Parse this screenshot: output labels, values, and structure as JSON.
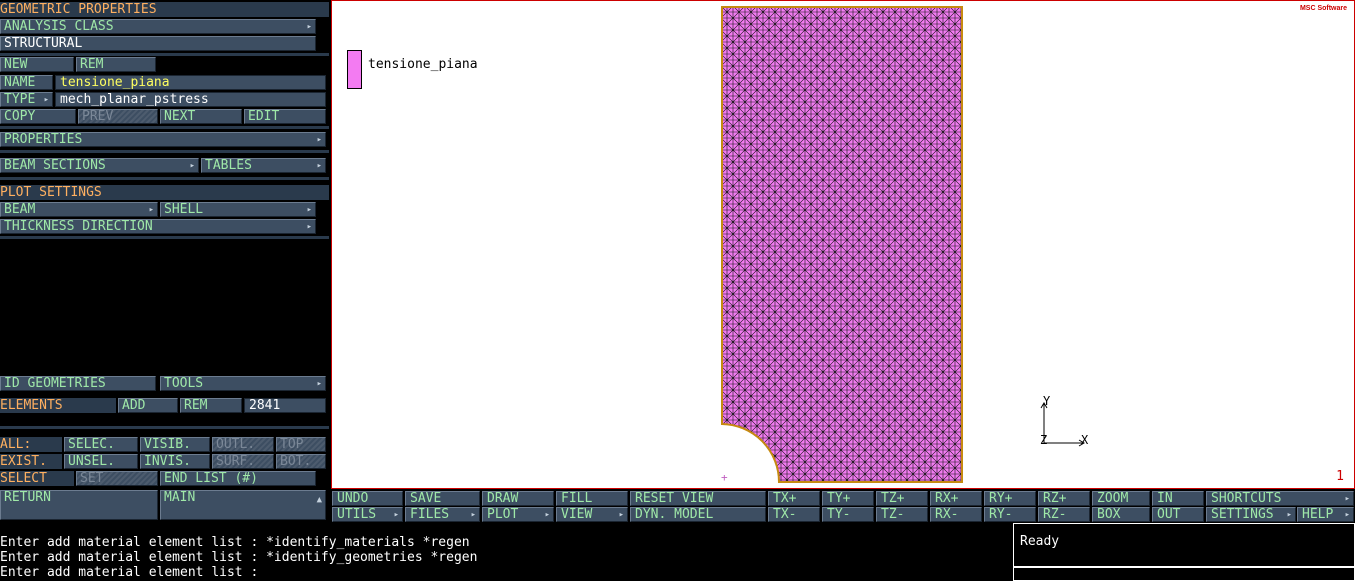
{
  "left_panel": {
    "geometric_properties": "GEOMETRIC PROPERTIES",
    "analysis_class": "ANALYSIS CLASS",
    "analysis_class_value": "STRUCTURAL",
    "new": "NEW",
    "rem": "REM",
    "name_label": "NAME",
    "name_value": "tensione_piana",
    "type_label": "TYPE",
    "type_value": "mech_planar_pstress",
    "copy": "COPY",
    "prev": "PREV",
    "next": "NEXT",
    "edit": "EDIT",
    "properties": "PROPERTIES",
    "beam_sections": "BEAM SECTIONS",
    "tables": "TABLES",
    "plot_settings": "PLOT SETTINGS",
    "beam": "BEAM",
    "shell": "SHELL",
    "thickness_direction": "THICKNESS DIRECTION",
    "id_geometries": "ID GEOMETRIES",
    "tools": "TOOLS",
    "elements": "ELEMENTS",
    "add": "ADD",
    "rem2": "REM",
    "element_count": "2841",
    "all": "ALL:",
    "selec": "SELEC.",
    "visib": "VISIB.",
    "outl": "OUTL.",
    "top": "TOP",
    "exist": "EXIST.",
    "unsel": "UNSEL.",
    "invis": "INVIS.",
    "surf": "SURF.",
    "bot": "BOT.",
    "select": "SELECT",
    "set": "SET",
    "end_list": "END LIST (#)",
    "return": "RETURN",
    "main": "MAIN"
  },
  "viewport": {
    "legend_label": "tensione_piana",
    "legend_color": "#f37bf2",
    "viewport_number": "1",
    "logo": "MSC Software",
    "axis_y": "Y",
    "axis_x": "X",
    "axis_z": "Z",
    "origin_mark": "+"
  },
  "toolbar": {
    "row1": [
      "UNDO",
      "SAVE",
      "DRAW",
      "FILL",
      "RESET VIEW",
      "TX+",
      "TY+",
      "TZ+",
      "RX+",
      "RY+",
      "RZ+",
      "ZOOM",
      "IN",
      "SHORTCUTS"
    ],
    "row2": [
      "UTILS",
      "FILES",
      "PLOT",
      "VIEW",
      "DYN. MODEL",
      "TX-",
      "TY-",
      "TZ-",
      "RX-",
      "RY-",
      "RZ-",
      "BOX",
      "OUT",
      "SETTINGS",
      "HELP"
    ]
  },
  "console": {
    "lines": [
      "Enter add material element list : *identify_materials *regen",
      "Enter add material element list : *identify_geometries *regen",
      "Enter add material element list : "
    ]
  },
  "status": {
    "text": "Ready"
  }
}
